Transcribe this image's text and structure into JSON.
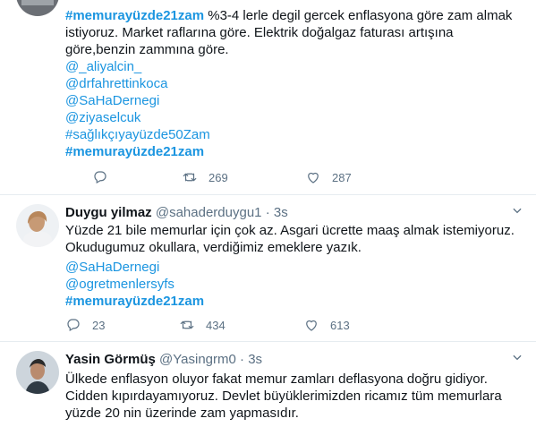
{
  "tweets": [
    {
      "lines": [
        {
          "hashtag": "#memurayüzde21zam",
          "text": " %3-4 lerle degil gercek enflasyona göre zam almak"
        },
        {
          "text": "istiyoruz. Market raflarına göre. Elektrik doğalgaz faturası artışına"
        },
        {
          "text": "göre,benzin zammına göre."
        }
      ],
      "mentions": [
        "@_aliyalcin_",
        "@drfahrettinkoca",
        "@SaHaDernegi",
        "@ziyaselcuk",
        "#sağlıkçıyayüzde50Zam"
      ],
      "hashtag_bold": "#memurayüzde21zam",
      "stats": {
        "reply": "",
        "retweet": "269",
        "like": "287"
      }
    },
    {
      "name": "Duygu yilmaz",
      "handle": "@sahaderduygu1",
      "sep": "·",
      "time": "3s",
      "lines": [
        "Yüzde 21 bile memurlar için çok az. Asgari ücrette maaş almak istemiyoruz.",
        "Okudugumuz okullara, verdiğimiz emeklere yazık."
      ],
      "mentions": [
        "@SaHaDernegi",
        "@ogretmenlersyfs"
      ],
      "hashtag_bold": "#memurayüzde21zam",
      "stats": {
        "reply": "23",
        "retweet": "434",
        "like": "613"
      }
    },
    {
      "name": "Yasin Görmüş",
      "handle": "@Yasingrm0",
      "sep": "·",
      "time": "3s",
      "lines": [
        "Ülkede enflasyon oluyor fakat memur zamları deflasyona doğru gidiyor.",
        "Cidden kıpırdayamıyoruz. Devlet büyüklerimizden ricamız tüm memurlara",
        "yüzde 20 nin üzerinde zam yapmasıdır."
      ]
    }
  ]
}
